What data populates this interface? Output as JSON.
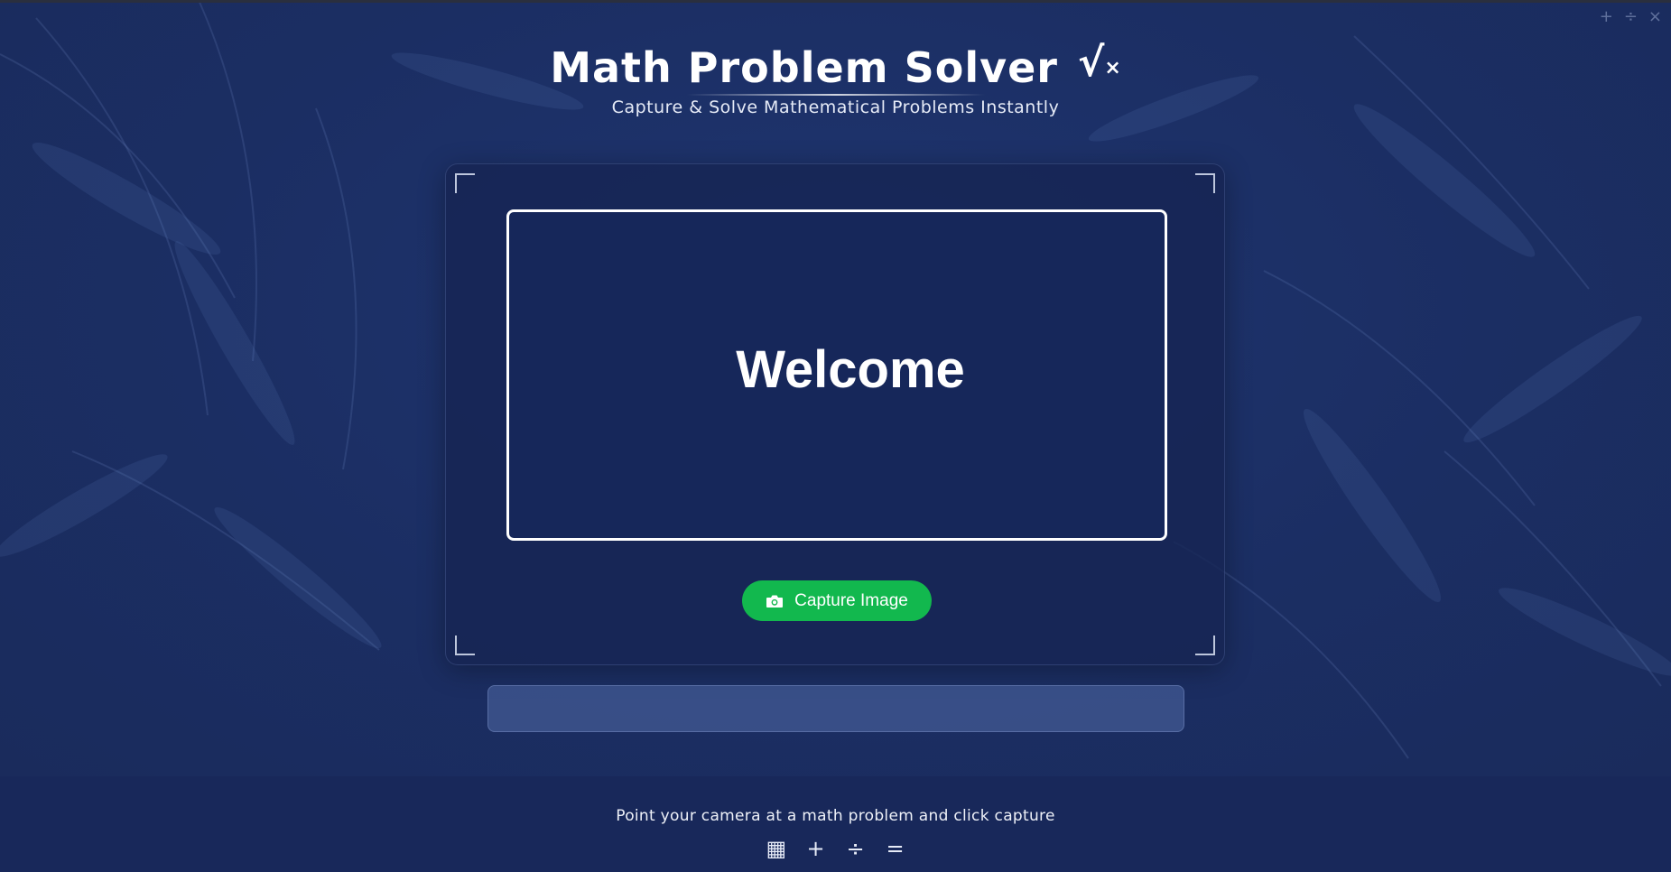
{
  "window": {
    "controls": [
      "+",
      "÷",
      "×"
    ]
  },
  "header": {
    "title": "Math Problem Solver",
    "icon": "sqrt-x-icon",
    "subtitle": "Capture & Solve Mathematical Problems Instantly"
  },
  "camera": {
    "display_text": "Welcome",
    "capture_button_label": "Capture Image",
    "capture_icon": "camera-icon"
  },
  "result": {
    "text": ""
  },
  "footer": {
    "instruction": "Point your camera at a math problem and click capture",
    "icons": [
      {
        "name": "calculator-icon",
        "glyph": "▦"
      },
      {
        "name": "plus-icon",
        "glyph": "+"
      },
      {
        "name": "divide-icon",
        "glyph": "÷"
      },
      {
        "name": "equals-icon",
        "glyph": "="
      }
    ]
  },
  "colors": {
    "background": "#1c2f62",
    "accent_green": "#12b84e",
    "text": "#ffffff"
  }
}
